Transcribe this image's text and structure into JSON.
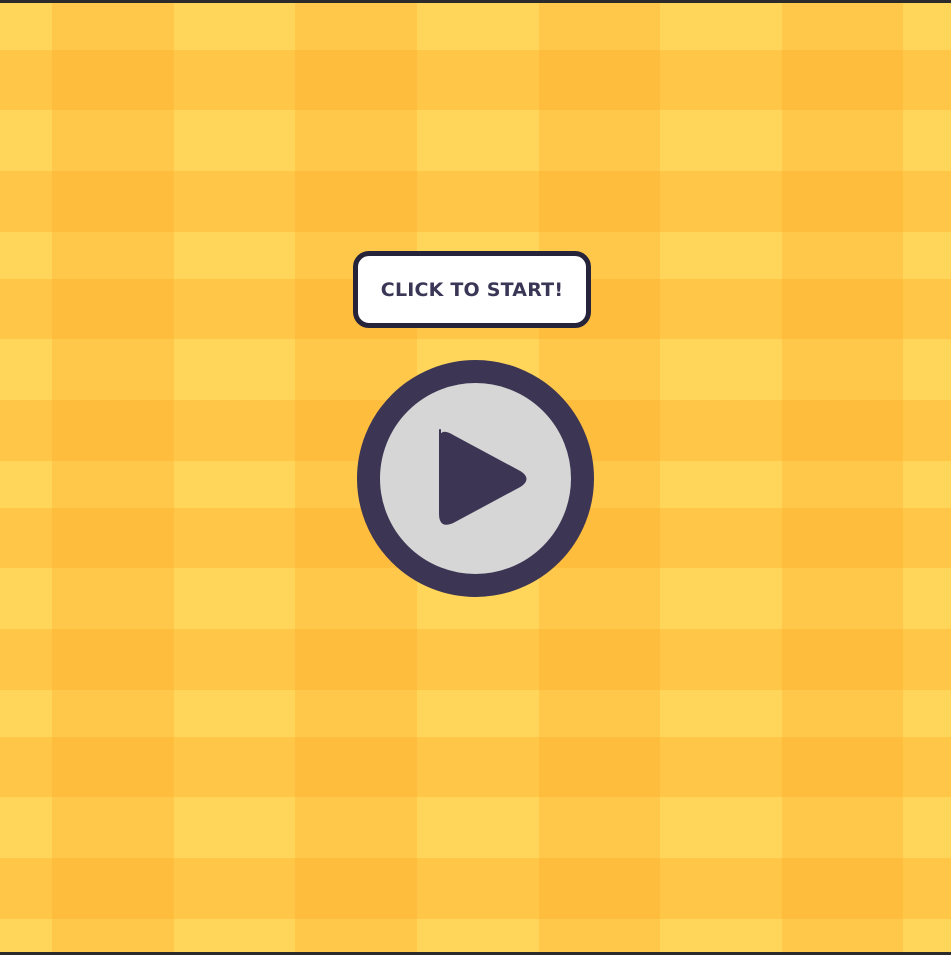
{
  "start_prompt": {
    "label": "CLICK TO START!"
  },
  "play_button": {
    "icon": "play-icon"
  },
  "colors": {
    "background_light": "#FFD65A",
    "background_dark": "#FFB73E",
    "button_ring": "#3C3654",
    "button_fill": "#D6D6D6",
    "label_text": "#3A3655",
    "label_border": "#25243A"
  }
}
